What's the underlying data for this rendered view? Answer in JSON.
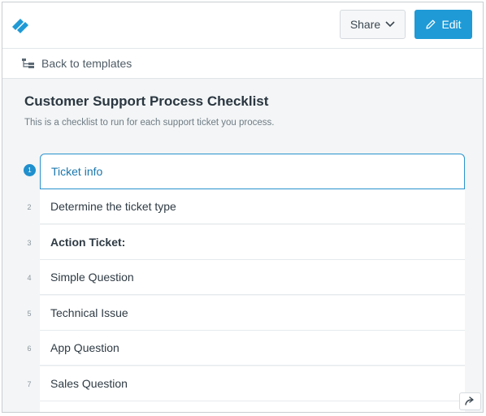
{
  "header": {
    "share_label": "Share",
    "edit_label": "Edit",
    "logo_icon": "process-street-logo",
    "accent_color": "#1f9ad6"
  },
  "back": {
    "label": "Back to templates",
    "icon": "templates-tree-icon"
  },
  "checklist": {
    "title": "Customer Support Process Checklist",
    "description": "This is a checklist to run for each support ticket you process.",
    "steps": [
      {
        "num": "1",
        "label": "Ticket info",
        "active": true
      },
      {
        "num": "2",
        "label": "Determine the ticket type"
      },
      {
        "num": "3",
        "label": "Action Ticket:",
        "bold": true
      },
      {
        "num": "4",
        "label": "Simple Question"
      },
      {
        "num": "5",
        "label": "Technical Issue"
      },
      {
        "num": "6",
        "label": "App Question"
      },
      {
        "num": "7",
        "label": "Sales Question"
      },
      {
        "num": "",
        "label": ""
      }
    ]
  },
  "corner": {
    "icon": "redo-arrow-icon"
  }
}
